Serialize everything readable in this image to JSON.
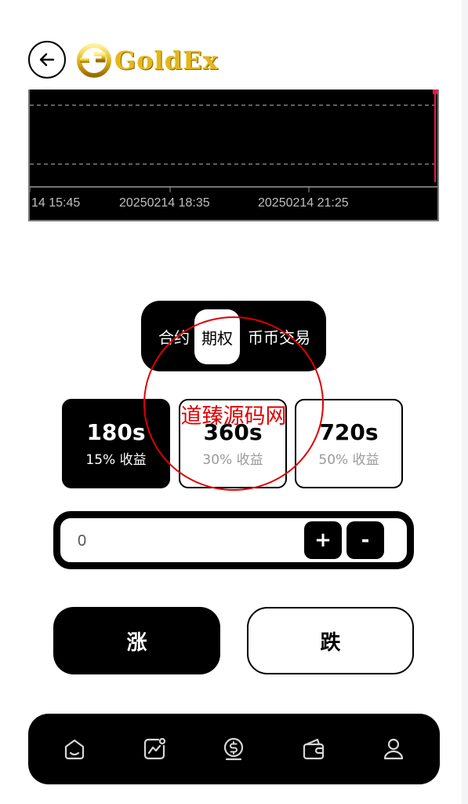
{
  "header": {
    "back_icon": "arrow-left-icon",
    "logo_text": "GoldEx",
    "logo_color": "#e3b71e"
  },
  "chart": {
    "x_labels": [
      "14 15:45",
      "20250214 18:35",
      "20250214 21:25"
    ],
    "cursor_color": "#e8174f"
  },
  "tabs": [
    {
      "label": "合约"
    },
    {
      "label": "期权"
    },
    {
      "label": "币币交易"
    }
  ],
  "tabs_active": 1,
  "durations": [
    {
      "seconds": "180s",
      "rate": "15% 收益"
    },
    {
      "seconds": "360s",
      "rate": "30% 收益"
    },
    {
      "seconds": "720s",
      "rate": "50% 收益"
    }
  ],
  "durations_active": 0,
  "amount": {
    "value": "0",
    "plus_label": "+",
    "minus_label": "-"
  },
  "actions": {
    "rise_label": "涨",
    "fall_label": "跌"
  },
  "bottom_nav": [
    {
      "icon": "home-icon"
    },
    {
      "icon": "chart-icon"
    },
    {
      "icon": "dollar-coin-icon"
    },
    {
      "icon": "wallet-icon"
    },
    {
      "icon": "user-icon"
    }
  ],
  "watermark": {
    "text": "道臻源码网",
    "color": "#e00000"
  }
}
